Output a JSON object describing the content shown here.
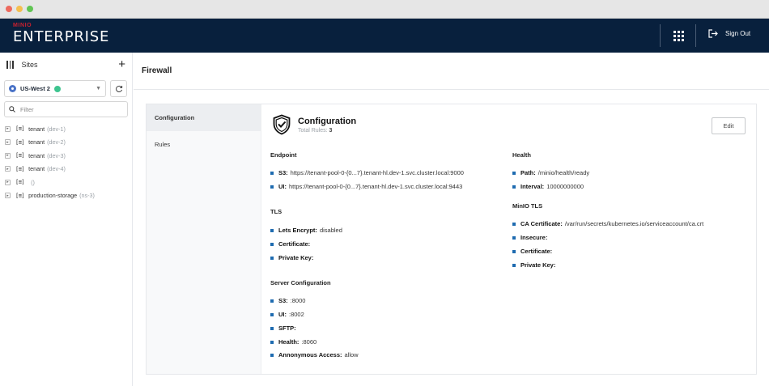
{
  "window": {
    "dots": [
      "#ed6a5e",
      "#f5bf4f",
      "#61c554"
    ]
  },
  "header": {
    "brand_top": "MINIO",
    "brand_main": "ENTERPRISE",
    "signout_label": "Sign Out",
    "bg_color": "#08203d"
  },
  "sidebar": {
    "title": "Sites",
    "site_select": {
      "value": "US-West 2",
      "status_color": "#3ec48f"
    },
    "filter_placeholder": "Filter",
    "tree": [
      {
        "name": "tenant",
        "sub": "(dev-1)"
      },
      {
        "name": "tenant",
        "sub": "(dev-2)"
      },
      {
        "name": "tenant",
        "sub": "(dev-3)"
      },
      {
        "name": "tenant",
        "sub": "(dev-4)"
      },
      {
        "name": "",
        "sub": "()"
      },
      {
        "name": "production-storage",
        "sub": "(ns-3)"
      }
    ]
  },
  "page": {
    "title": "Firewall"
  },
  "tabs": [
    {
      "label": "Configuration",
      "active": true
    },
    {
      "label": "Rules",
      "active": false
    }
  ],
  "config": {
    "title": "Configuration",
    "total_rules_label": "Total Rules:",
    "total_rules_value": "3",
    "edit_label": "Edit",
    "endpoint": {
      "title": "Endpoint",
      "items": [
        {
          "key": "S3:",
          "value": "https://tenant-pool-0-{0...7}.tenant-hl.dev-1.svc.cluster.local:9000"
        },
        {
          "key": "UI:",
          "value": "https://tenant-pool-0-{0...7}.tenant-hl.dev-1.svc.cluster.local:9443"
        }
      ]
    },
    "tls": {
      "title": "TLS",
      "items": [
        {
          "key": "Lets Encrypt:",
          "value": "disabled"
        },
        {
          "key": "Certificate:",
          "value": ""
        },
        {
          "key": "Private Key:",
          "value": ""
        }
      ]
    },
    "server": {
      "title": "Server Configuration",
      "items": [
        {
          "key": "S3:",
          "value": ":8000"
        },
        {
          "key": "UI:",
          "value": ":8002"
        },
        {
          "key": "SFTP:",
          "value": ""
        },
        {
          "key": "Health:",
          "value": ":8060"
        },
        {
          "key": "Annonymous Access:",
          "value": "allow"
        }
      ]
    },
    "health": {
      "title": "Health",
      "items": [
        {
          "key": "Path:",
          "value": "/minio/health/ready"
        },
        {
          "key": "Interval:",
          "value": "10000000000"
        }
      ]
    },
    "minio_tls": {
      "title": "MinIO TLS",
      "items": [
        {
          "key": "CA Certificate:",
          "value": "/var/run/secrets/kubernetes.io/serviceaccount/ca.crt"
        },
        {
          "key": "Insecure:",
          "value": ""
        },
        {
          "key": "Certificate:",
          "value": ""
        },
        {
          "key": "Private Key:",
          "value": ""
        }
      ]
    },
    "accent_color": "#1e6bb0"
  }
}
